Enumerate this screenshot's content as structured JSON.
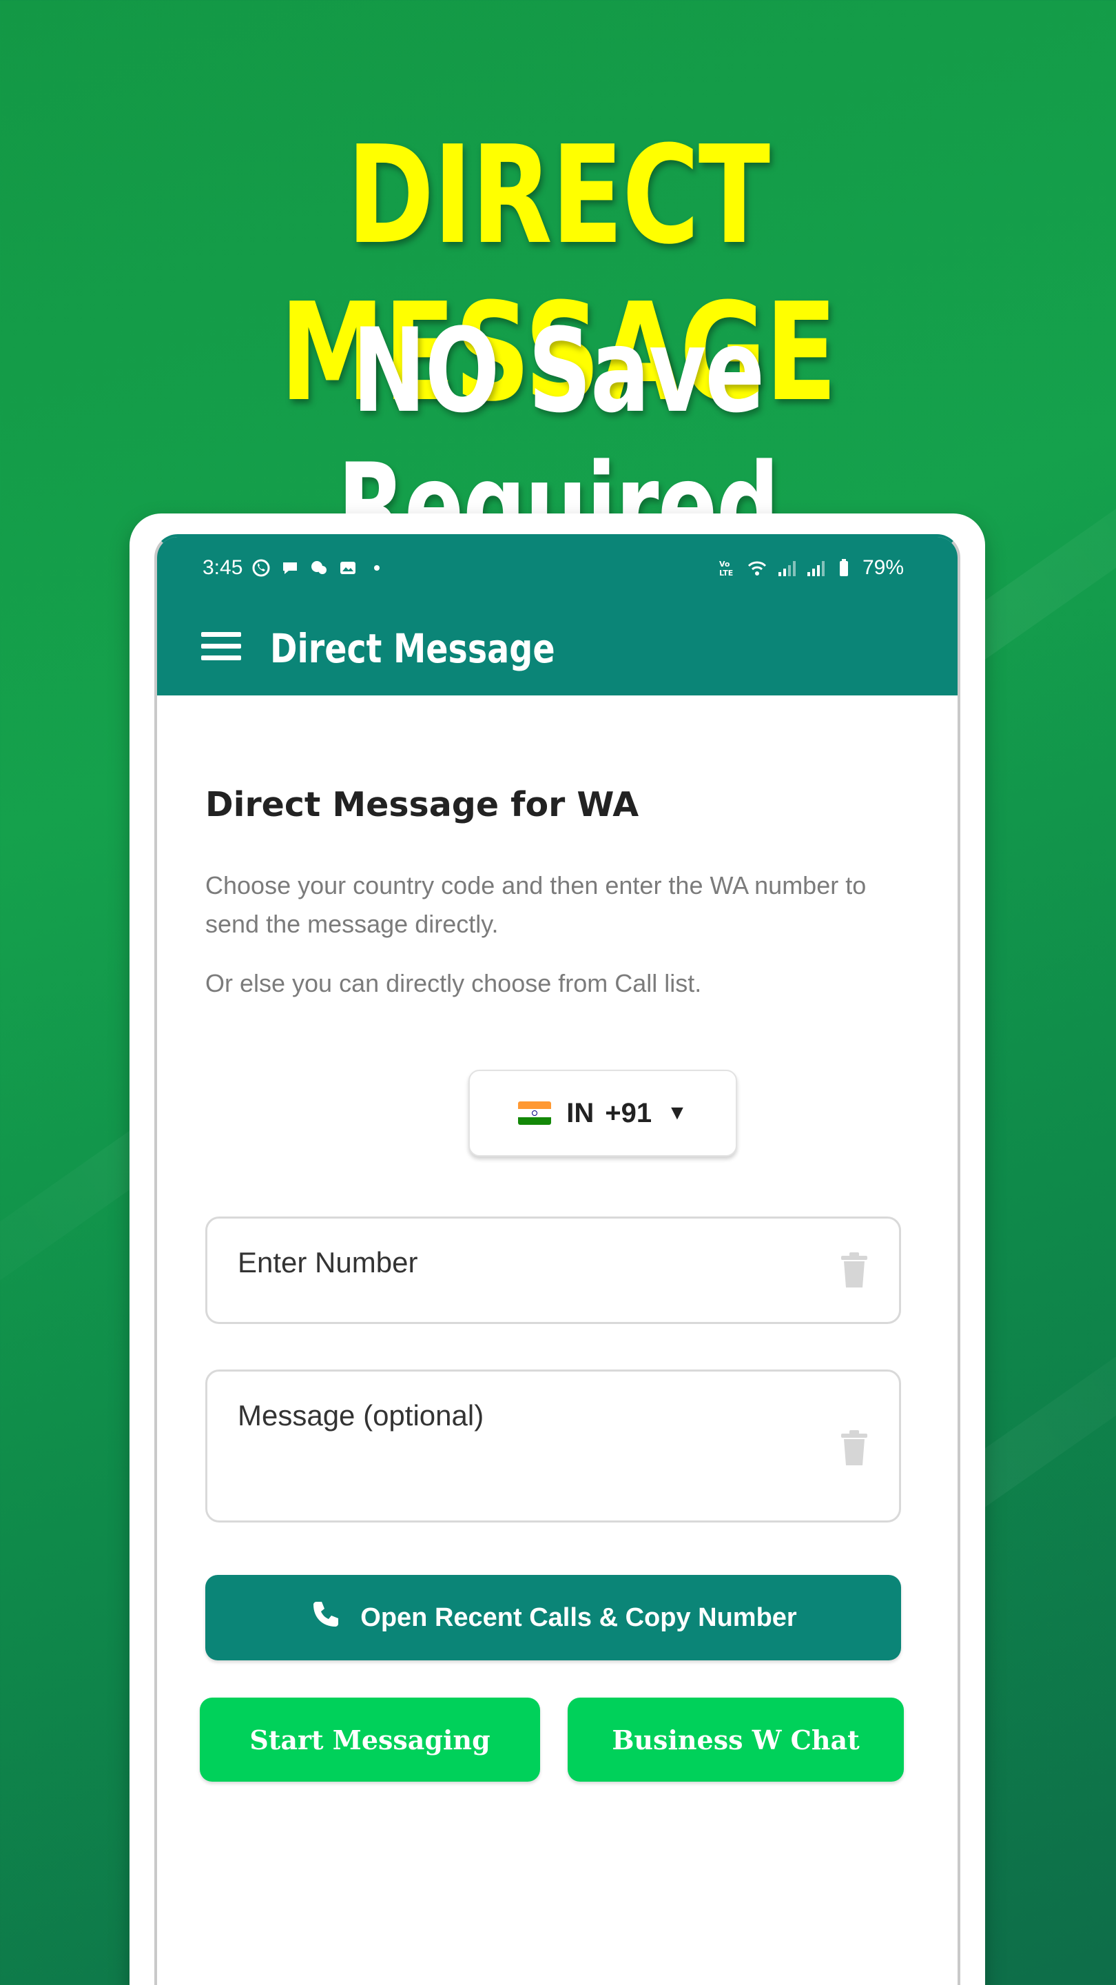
{
  "banner": {
    "headline": "DIRECT MESSAGE",
    "subheadline": "NO Save Required"
  },
  "status_bar": {
    "time": "3:45",
    "battery": "79%"
  },
  "app_bar": {
    "title": "Direct Message"
  },
  "main": {
    "section_title": "Direct Message for WA",
    "description_1": "Choose your country code and then enter the WA number to send the message directly.",
    "description_2": "Or else you can directly choose from Call list.",
    "country_picker": {
      "country": "IN",
      "code": "+91",
      "arrow": "▼"
    },
    "number_field": {
      "placeholder": "Enter Number",
      "value": ""
    },
    "message_field": {
      "placeholder": "Message (optional)",
      "value": ""
    },
    "recent_calls_button": "Open Recent Calls & Copy Number",
    "start_messaging_button": "Start Messaging",
    "business_chat_button": "Business W Chat"
  },
  "colors": {
    "background": "#139845",
    "headline": "#ffff00",
    "app_bar": "#0b8577",
    "accent_button": "#00d15a"
  }
}
